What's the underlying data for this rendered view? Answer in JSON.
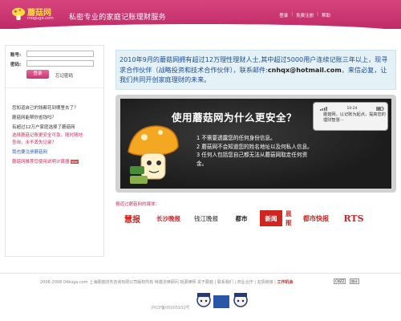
{
  "header": {
    "logo_text": "蘑菇网",
    "logo_sub": "moguge.com",
    "slogan": "私密专业的家庭记账理财服务",
    "links": [
      "登录",
      "免费注册",
      "帮助"
    ],
    "brand_color": "#c93672"
  },
  "login": {
    "account_label": "账号:",
    "password_label": "密码:",
    "login_button": "登录",
    "forgot_link": "忘记密码"
  },
  "sidebar": {
    "items": [
      "您知道自己的钱都花到哪里去了？",
      "蘑菇网能帮你省钱吗？",
      "有超过12万户家庭选择了蘑菇网",
      "选择蘑菇记账更安全可靠，随时随地",
      "查询，永不丢失记录？",
      "我也要注册蘑菇网",
      "蘑菇网推荐您使用说明计算器"
    ],
    "new_badge": "new"
  },
  "notice": {
    "text": "2010年9月的蘑菇网拥有超过12万理性理财人士,其中超过5000用户连续记账三年以上，现寻求合作伙伴（战略投资和技术合作伙伴），联系邮件:",
    "email": "cnhqx@hotmail.com",
    "tail": "，来信必复，让我们共同开创家庭理财的未来。"
  },
  "banner": {
    "title": "使用蘑菇网为什么更安全？",
    "bullets": [
      "1 不需要透露您的任何身份信息。",
      "2 蘑菇网不会知道您的姓名地址以及何私人信息。",
      "3 任何人包括您自己都无法从蘑菇网取走任何资金。"
    ],
    "bubble": "蘑菇网，以记账为起点，提高您的理财智慧···",
    "bubble_time": "10:24"
  },
  "media": {
    "title": "报道过蘑菇网的媒体：",
    "logos": [
      "慧报",
      "长沙晚报",
      "钱江晚报",
      "都市",
      "新闻",
      "晨报",
      "都市快报",
      "RTS"
    ]
  },
  "footer": {
    "copyright": "2006-2008 04kuga.com 上海蘑菇财务咨询有限公司版权所有  特邀法律顾问 桃源律师  关于蘑菇  |  联系我们  |  商业合作  |  友情链接  |",
    "hot": "工作机会",
    "icp": "沪ICP备05005932号",
    "badges": [
      "CNZZ",
      "统计"
    ]
  }
}
